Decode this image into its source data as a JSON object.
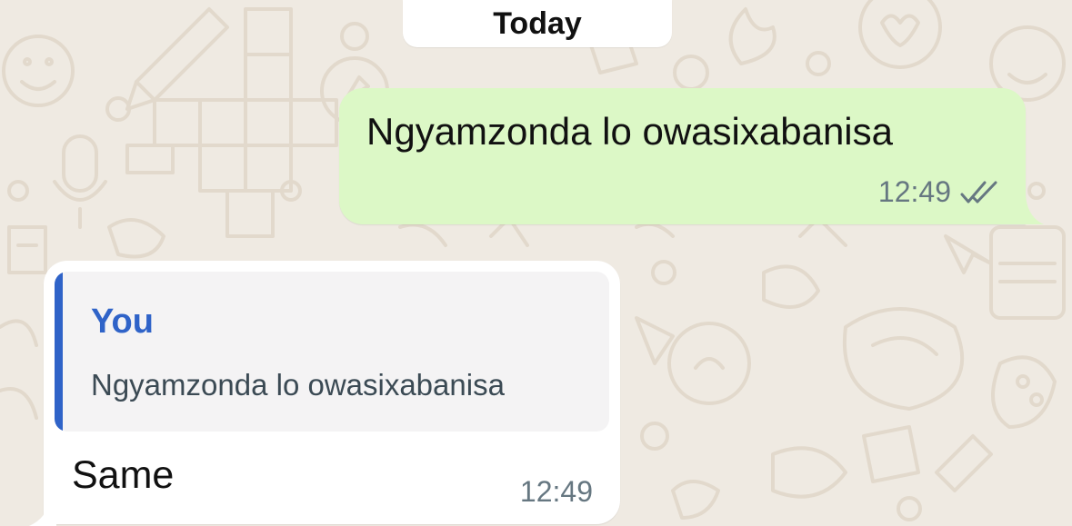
{
  "date_separator": {
    "label": "Today"
  },
  "messages": [
    {
      "direction": "outgoing",
      "text": "Ngyamzonda lo owasixabanisa",
      "time": "12:49",
      "status_icon": "double-check-icon",
      "bubble_color": "#dcf8c6"
    },
    {
      "direction": "incoming",
      "quoted": {
        "author": "You",
        "text": "Ngyamzonda lo owasixabanisa",
        "accent_color": "#2f63c8"
      },
      "text": "Same",
      "time": "12:49",
      "bubble_color": "#ffffff"
    }
  ],
  "colors": {
    "wallpaper": "#efeae2",
    "wallpaper_pattern": "#e2d9cc"
  }
}
